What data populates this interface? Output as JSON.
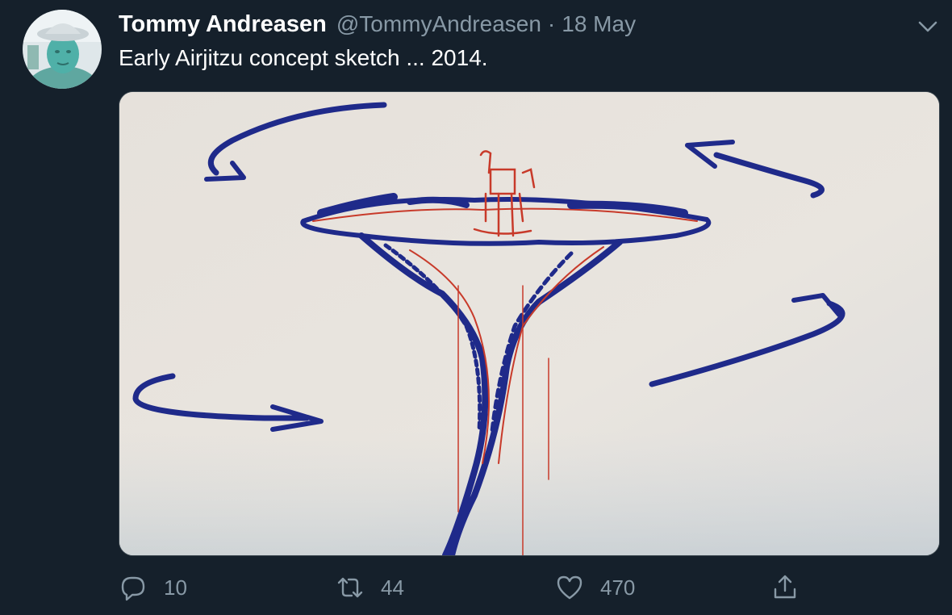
{
  "tweet": {
    "author_name": "Tommy Andreasen",
    "author_handle": "@TommyAndreasen",
    "separator": "·",
    "date": "18 May",
    "text": "Early Airjitzu concept sketch ... 2014.",
    "replies": "10",
    "retweets": "44",
    "likes": "470"
  },
  "icons": {
    "menu": "chevron-down-icon",
    "reply": "reply-icon",
    "retweet": "retweet-icon",
    "like": "heart-icon",
    "share": "share-icon"
  },
  "colors": {
    "background": "#15202b",
    "secondary_text": "#8899a6",
    "border": "#38444d",
    "ink_blue": "#1f2a8a",
    "ink_red": "#c83a2a"
  }
}
